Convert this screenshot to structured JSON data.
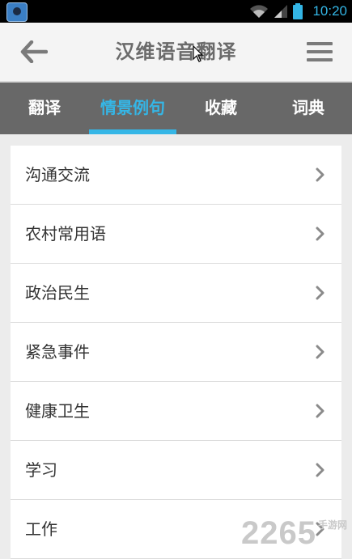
{
  "status_bar": {
    "time": "10:20",
    "colors": {
      "time": "#33b5e5"
    },
    "icons": [
      "app-icon",
      "wifi-icon",
      "cell-signal-icon",
      "battery-icon"
    ]
  },
  "header": {
    "title": "汉维语音翻译",
    "icons": {
      "back": "arrow-left-icon",
      "menu": "hamburger-menu-icon"
    }
  },
  "tabs": [
    {
      "label": "翻译",
      "active": false
    },
    {
      "label": "情景例句",
      "active": true
    },
    {
      "label": "收藏",
      "active": false
    },
    {
      "label": "词典",
      "active": false
    }
  ],
  "colors": {
    "accent": "#35b6e6",
    "tabbar": "#686868",
    "titlebar": "#f4f4f4",
    "background": "#ececec"
  },
  "categories": [
    {
      "label": "沟通交流"
    },
    {
      "label": "农村常用语"
    },
    {
      "label": "政治民生"
    },
    {
      "label": "紧急事件"
    },
    {
      "label": "健康卫生"
    },
    {
      "label": "学习"
    },
    {
      "label": "工作"
    }
  ],
  "watermark": {
    "number": "2265",
    "suffix": "手游网"
  }
}
